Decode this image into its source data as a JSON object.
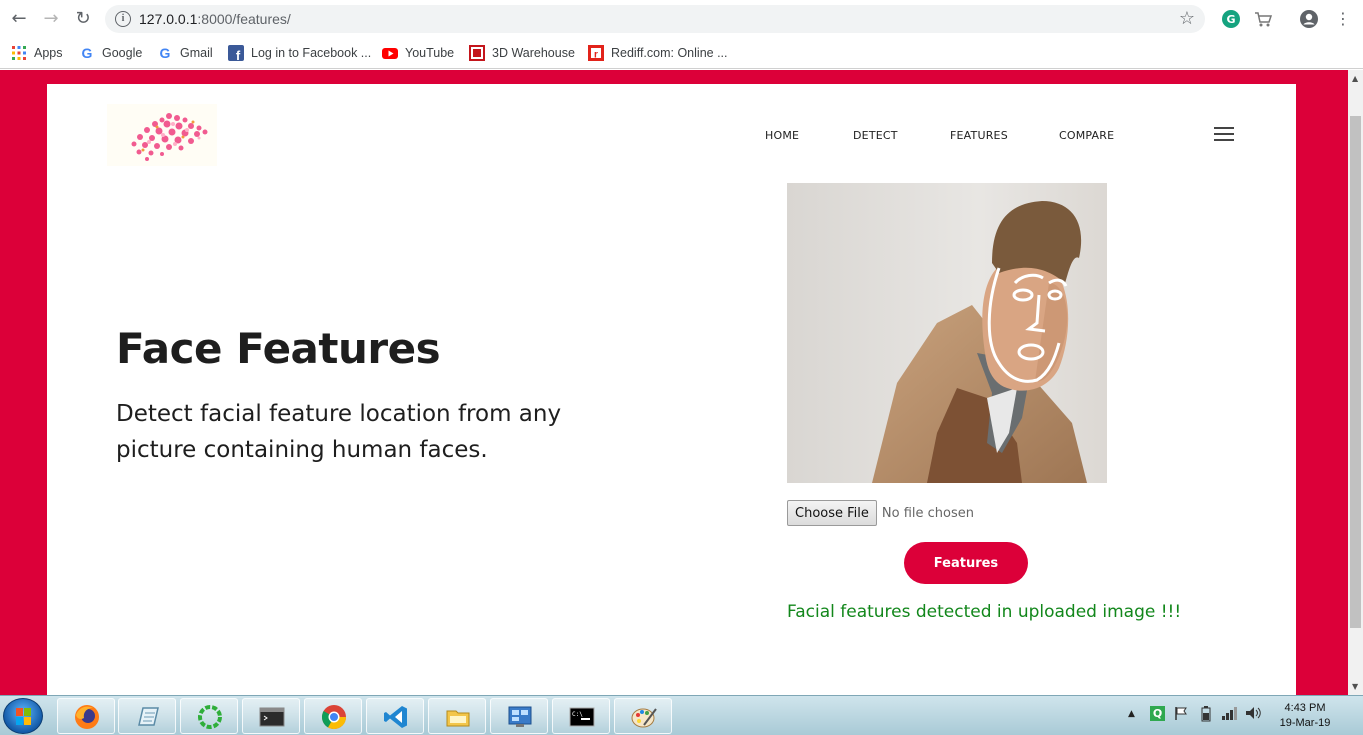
{
  "browser": {
    "url_host": "127.0.0.1",
    "url_path": ":8000/features/",
    "bookmarks": [
      {
        "label": "Apps",
        "icon": "apps-grid-icon"
      },
      {
        "label": "Google",
        "icon": "google-icon"
      },
      {
        "label": "Gmail",
        "icon": "google-icon"
      },
      {
        "label": "Log in to Facebook ...",
        "icon": "facebook-icon"
      },
      {
        "label": "YouTube",
        "icon": "youtube-icon"
      },
      {
        "label": "3D Warehouse",
        "icon": "warehouse-icon"
      },
      {
        "label": "Rediff.com: Online ...",
        "icon": "rediff-icon"
      }
    ]
  },
  "nav": {
    "items": [
      "HOME",
      "DETECT",
      "FEATURES",
      "COMPARE"
    ]
  },
  "hero": {
    "title": "Face Features",
    "subtitle": "Detect facial feature location from any picture containing human faces."
  },
  "upload": {
    "choose_label": "Choose File",
    "no_file_label": "No file chosen",
    "submit_label": "Features",
    "status_message": "Facial features detected in uploaded image !!!"
  },
  "colors": {
    "accent": "#dc0039",
    "success": "#12871b"
  },
  "taskbar": {
    "apps": [
      "firefox-icon",
      "notepad-icon",
      "spinner-icon",
      "terminal-icon",
      "chrome-icon",
      "vscode-icon",
      "file-explorer-icon",
      "control-panel-icon",
      "cmd-icon",
      "paint-icon"
    ],
    "time": "4:43 PM",
    "date": "19-Mar-19"
  }
}
